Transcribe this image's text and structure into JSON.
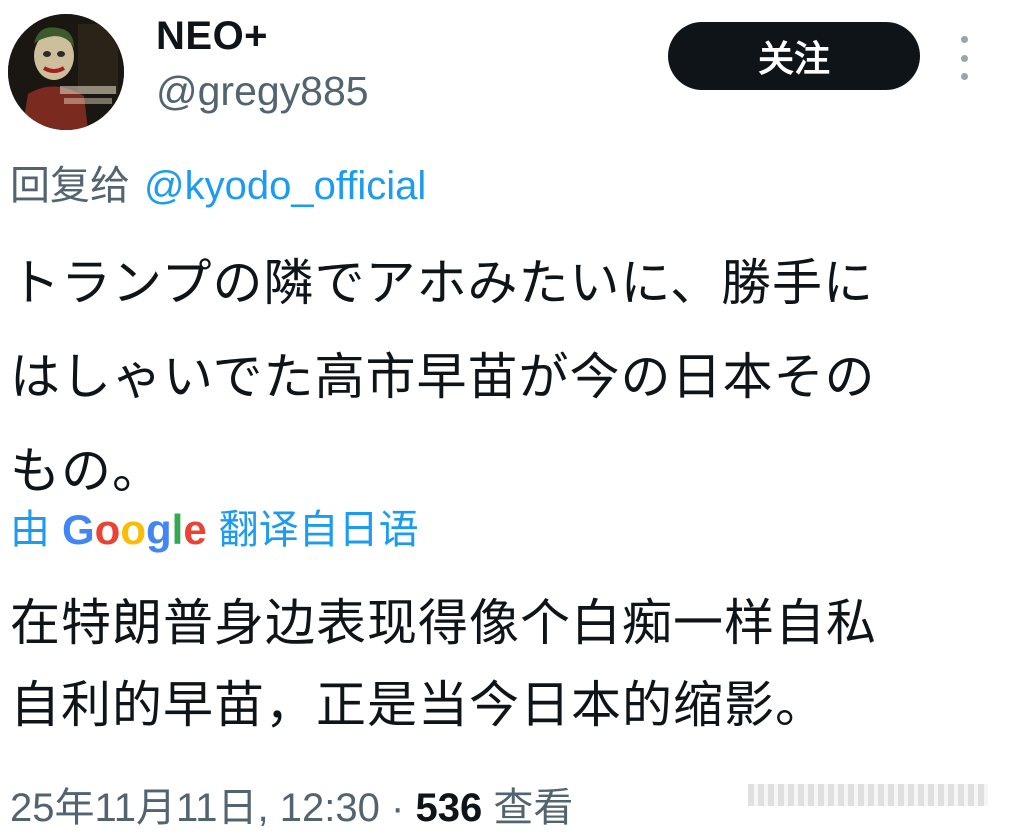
{
  "author": {
    "display_name": "NEO+",
    "handle": "@gregy885",
    "avatar_icon": "joker-portrait-avatar"
  },
  "follow_button": {
    "label": "关注"
  },
  "more_icon": "more-vertical-icon",
  "reply": {
    "prefix": "回复给",
    "mention": "@kyodo_official"
  },
  "tweet": {
    "lines": [
      "トランプの隣でアホみたいに、勝手に",
      "はしゃいでた高市早苗が今の日本その",
      "もの。"
    ]
  },
  "translation": {
    "prefix": "由",
    "provider": "Google",
    "suffix": "翻译自日语",
    "lines": [
      "在特朗普身边表现得像个白痴一样自私",
      "自利的早苗，正是当今日本的缩影。"
    ]
  },
  "meta": {
    "timestamp": "25年11月11日, 12:30",
    "separator": "·",
    "views_count": "536",
    "views_label": "查看"
  },
  "colors": {
    "link": "#1d9bf0",
    "secondary_text": "#536471",
    "primary_text": "#0f1419",
    "follow_bg": "#0f1419"
  }
}
